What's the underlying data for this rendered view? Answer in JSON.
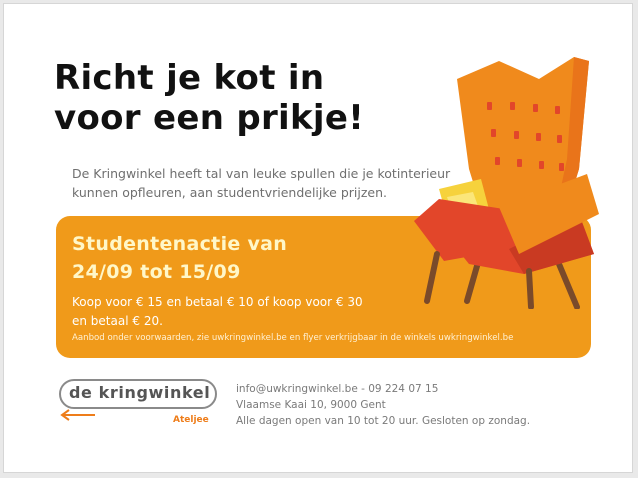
{
  "headline": {
    "line1": "Richt je kot in",
    "line2": "voor een prikje!"
  },
  "intro": {
    "line1": "De Kringwinkel heeft tal van leuke spullen die je kotinterieur",
    "line2": "kunnen opfleuren, aan studentvriendelijke prijzen."
  },
  "promo": {
    "title_line1": "Studentenactie van",
    "title_line2": "24/09 tot 15/09",
    "text_line1": "Koop voor € 15 en betaal € 10 of koop voor € 30",
    "text_line2": "en betaal € 20.",
    "note": "Aanbod onder voorwaarden, zie uwkringwinkel.be en flyer verkrijgbaar in de winkels uwkringwinkel.be"
  },
  "logo": {
    "name": "de kringwinkel",
    "sub": "Ateljee"
  },
  "contact": {
    "line1": "info@uwkringwinkel.be - 09 224 07 15",
    "line2": "Vlaamse Kaai 10, 9000 Gent",
    "line3": "Alle dagen open van 10 tot 20 uur. Gesloten op zondag."
  },
  "colors": {
    "promo_background": "#f09a1a",
    "chair_orange": "#f08a1c",
    "chair_red": "#e2462a",
    "chair_legs": "#7a4a2a",
    "cushion_yellow": "#f6d23c",
    "logo_accent": "#ee7d1a"
  },
  "icons": {
    "chair": "armchair-illustration",
    "logo_arrow": "arrow-left-icon"
  }
}
